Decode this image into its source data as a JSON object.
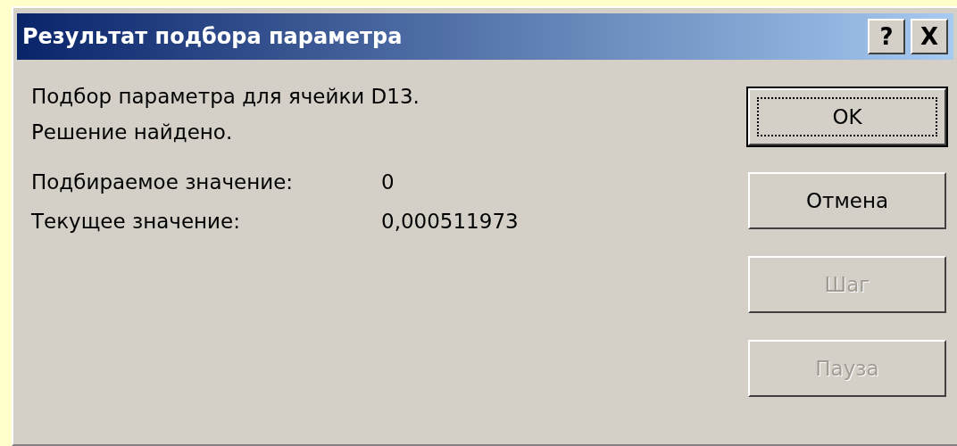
{
  "window": {
    "title": "Результат подбора параметра",
    "title_buttons": [
      {
        "kind": "help",
        "label": "?"
      },
      {
        "kind": "close",
        "label": "X"
      }
    ]
  },
  "messages": [
    "Подбор параметра для ячейки D13.",
    "Решение найдено."
  ],
  "values": [
    {
      "label": "Подбираемое значение:",
      "value": "0"
    },
    {
      "label": "Текущее значение:",
      "value": "0,000511973"
    }
  ],
  "buttons": [
    {
      "label": "OK",
      "default": true,
      "disabled": false
    },
    {
      "label": "Отмена",
      "default": false,
      "disabled": false
    },
    {
      "label": "Шаг",
      "default": false,
      "disabled": true
    },
    {
      "label": "Пауза",
      "default": false,
      "disabled": true
    }
  ]
}
